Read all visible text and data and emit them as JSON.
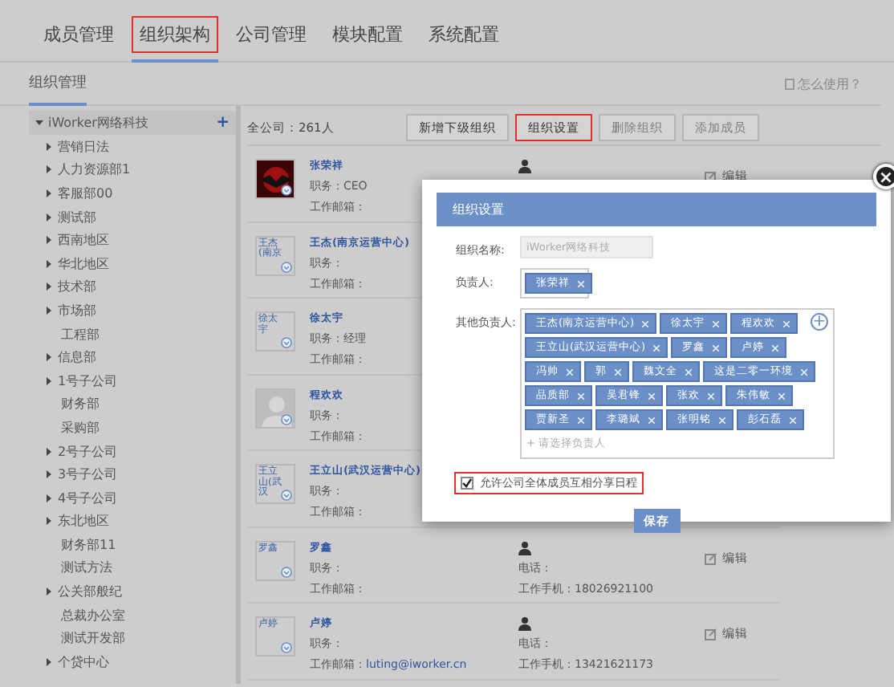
{
  "nav_tabs": [
    {
      "label": "成员管理",
      "selected": false,
      "highlighted": false
    },
    {
      "label": "组织架构",
      "selected": true,
      "highlighted": true
    },
    {
      "label": "公司管理",
      "selected": false,
      "highlighted": false
    },
    {
      "label": "模块配置",
      "selected": false,
      "highlighted": false
    },
    {
      "label": "系统配置",
      "selected": false,
      "highlighted": false
    }
  ],
  "sub_header": {
    "title": "组织管理",
    "help_link": "怎么使用？"
  },
  "tree": {
    "root": {
      "label": "iWorker网络科技",
      "expanded": true,
      "add": "+"
    },
    "children": [
      {
        "label": "营销日法",
        "has_children": true
      },
      {
        "label": "人力资源部1",
        "has_children": true
      },
      {
        "label": "客服部00",
        "has_children": true
      },
      {
        "label": "测试部",
        "has_children": true
      },
      {
        "label": "西南地区",
        "has_children": true
      },
      {
        "label": "华北地区",
        "has_children": true
      },
      {
        "label": "技术部",
        "has_children": true
      },
      {
        "label": "市场部",
        "has_children": true
      },
      {
        "label": "工程部",
        "has_children": false
      },
      {
        "label": "信息部",
        "has_children": true
      },
      {
        "label": "1号子公司",
        "has_children": true
      },
      {
        "label": "财务部",
        "has_children": false
      },
      {
        "label": "采购部",
        "has_children": false
      },
      {
        "label": "2号子公司",
        "has_children": true
      },
      {
        "label": "3号子公司",
        "has_children": true
      },
      {
        "label": "4号子公司",
        "has_children": true
      },
      {
        "label": "东北地区",
        "has_children": true
      },
      {
        "label": "财务部11",
        "has_children": false
      },
      {
        "label": "测试方法",
        "has_children": false
      },
      {
        "label": "公关部般纪",
        "has_children": true
      },
      {
        "label": "总裁办公室",
        "has_children": false
      },
      {
        "label": "测试开发部",
        "has_children": false
      },
      {
        "label": "个贷中心",
        "has_children": true
      }
    ]
  },
  "list_header": {
    "count": "全公司：261人",
    "buttons": [
      {
        "label": "新增下级组织",
        "disabled": false,
        "highlighted": false
      },
      {
        "label": "组织设置",
        "disabled": false,
        "highlighted": true
      },
      {
        "label": "删除组织",
        "disabled": true,
        "highlighted": false
      },
      {
        "label": "添加成员",
        "disabled": true,
        "highlighted": false
      }
    ]
  },
  "members": [
    {
      "name": "张荣祥",
      "title_label": "职务：CEO",
      "email_label": "工作邮箱：",
      "edit": "编辑"
    },
    {
      "kind": "broken",
      "alt": "王杰(南京",
      "name": "王杰(南京运营中心)",
      "title_label": "职务：",
      "email_label": "工作邮箱："
    },
    {
      "kind": "broken",
      "alt": "徐太宇",
      "name": "徐太宇",
      "title_label": "职务：经理",
      "email_label": "工作邮箱："
    },
    {
      "kind": "default",
      "name": "程欢欢",
      "title_label": "职务：",
      "email_label": "工作邮箱："
    },
    {
      "kind": "broken",
      "alt": "王立山(武汉",
      "name": "王立山(武汉运营中心)",
      "title_label": "职务：",
      "email_label": "工作邮箱："
    },
    {
      "kind": "broken",
      "alt": "罗鑫",
      "name": "罗鑫",
      "title_label": "职务：",
      "email_label": "工作邮箱：",
      "phone_label": "电话：",
      "mobile_label": "工作手机：18026921100",
      "edit": "编辑"
    },
    {
      "kind": "broken",
      "alt": "卢婷",
      "name": "卢婷",
      "title_label": "职务：",
      "email_label": "工作邮箱：",
      "email": "luting@iworker.cn",
      "phone_label": "电话：",
      "mobile_label": "工作手机：13421621173",
      "edit": "编辑"
    }
  ],
  "dialog": {
    "title": "组织设置",
    "close": "×",
    "name_label": "组织名称:",
    "name_value": "iWorker网络科技",
    "owner_label": "负责人:",
    "owners": [
      "张荣祥"
    ],
    "others_label": "其他负责人:",
    "others": [
      "王杰(南京运营中心)",
      "徐太宇",
      "程欢欢",
      "王立山(武汉运营中心)",
      "罗鑫",
      "卢婷",
      "冯帅",
      "郭",
      "魏文全",
      "这是二零一环境",
      "品质部",
      "吴君锋",
      "张欢",
      "朱伟敏",
      "贾新圣",
      "李璐斌",
      "张明铭",
      "彭石磊"
    ],
    "others_placeholder": "+ 请选择负责人",
    "add": "+",
    "share_option": {
      "label": "允许公司全体成员互相分享日程",
      "checked": true,
      "highlighted": true
    },
    "save": "保存"
  }
}
